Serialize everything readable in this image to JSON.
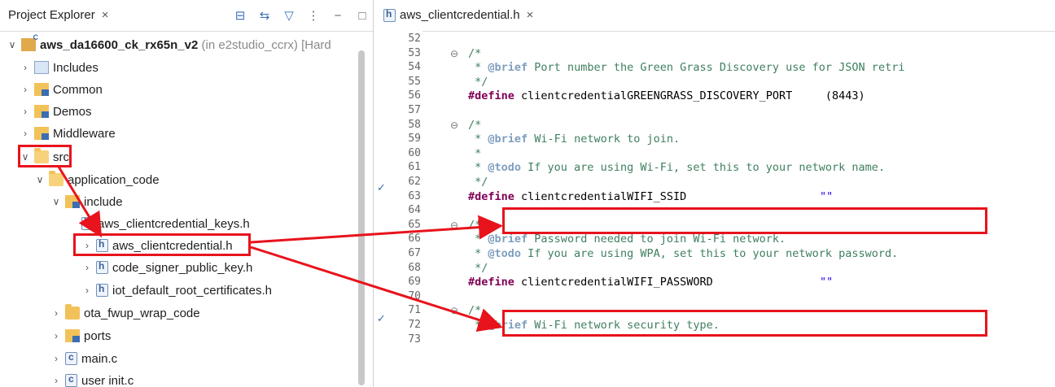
{
  "explorer": {
    "tab_label": "Project Explorer",
    "close_glyph": "×",
    "project": {
      "name": "aws_da16600_ck_rx65n_v2",
      "suffix": "(in e2studio_ccrx) [Hard"
    },
    "items": [
      {
        "label": "Includes"
      },
      {
        "label": "Common"
      },
      {
        "label": "Demos"
      },
      {
        "label": "Middleware"
      },
      {
        "label": "src"
      },
      {
        "label": "application_code"
      },
      {
        "label": "include"
      },
      {
        "label": "aws_clientcredential_keys.h"
      },
      {
        "label": "aws_clientcredential.h"
      },
      {
        "label": "code_signer_public_key.h"
      },
      {
        "label": "iot_default_root_certificates.h"
      },
      {
        "label": "ota_fwup_wrap_code"
      },
      {
        "label": "ports"
      },
      {
        "label": "main.c"
      },
      {
        "label": "user init.c"
      }
    ]
  },
  "editor": {
    "tab_label": "aws_clientcredential.h",
    "close_glyph": "×",
    "lines": [
      {
        "n": "52",
        "text": ""
      },
      {
        "n": "53",
        "text": "/*"
      },
      {
        "n": "54",
        "pre": " * ",
        "tag": "@brief",
        "text": " Port number the Green Grass Discovery use for JSON retri"
      },
      {
        "n": "55",
        "text": " */"
      },
      {
        "n": "56",
        "kw": "#define",
        "text": " clientcredentialGREENGRASS_DISCOVERY_PORT     (8443)"
      },
      {
        "n": "57",
        "text": ""
      },
      {
        "n": "58",
        "text": "/*"
      },
      {
        "n": "59",
        "pre": " * ",
        "tag": "@brief",
        "text": " Wi-Fi network to join."
      },
      {
        "n": "60",
        "text": " *"
      },
      {
        "n": "61",
        "pre": " * ",
        "tag": "@todo",
        "text": " If you are using Wi-Fi, set this to your network name."
      },
      {
        "n": "62",
        "text": " */"
      },
      {
        "n": "63",
        "kw": "#define",
        "text": " clientcredentialWIFI_SSID",
        "str": "\"\""
      },
      {
        "n": "64",
        "text": ""
      },
      {
        "n": "65",
        "text": "/*"
      },
      {
        "n": "66",
        "pre": " * ",
        "tag": "@brief",
        "text": " Password needed to join Wi-Fi network."
      },
      {
        "n": "67",
        "pre": " * ",
        "tag": "@todo",
        "text": " If you are using WPA, set this to your network password."
      },
      {
        "n": "68",
        "text": " */"
      },
      {
        "n": "69",
        "kw": "#define",
        "text": " clientcredentialWIFI_PASSWORD",
        "str": "\"\""
      },
      {
        "n": "70",
        "text": ""
      },
      {
        "n": "71",
        "text": "/*"
      },
      {
        "n": "72",
        "pre": " * ",
        "tag": "@brief",
        "text": " Wi-Fi network security type."
      },
      {
        "n": "73",
        "text": ""
      }
    ]
  },
  "colors": {
    "highlight": "#e8131c",
    "keyword": "#7f0055",
    "comment": "#3f7f5f",
    "string": "#2a00ff"
  }
}
